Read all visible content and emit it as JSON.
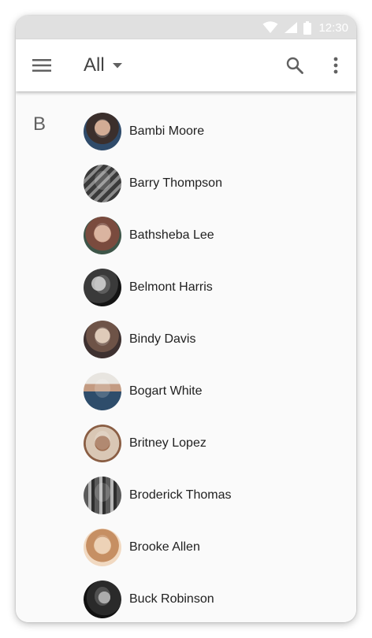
{
  "status_bar": {
    "time": "12:30",
    "icons": [
      "wifi-icon",
      "signal-icon",
      "battery-icon"
    ],
    "background": "#e0e0e0"
  },
  "app_bar": {
    "menu_icon": "menu-icon",
    "filter_label": "All",
    "filter_caret_icon": "arrow-drop-down-icon",
    "search_icon": "search-icon",
    "more_icon": "more-vert-icon"
  },
  "contacts": {
    "section_letter": "B",
    "items": [
      {
        "name": "Bambi Moore"
      },
      {
        "name": "Barry Thompson"
      },
      {
        "name": "Bathsheba Lee"
      },
      {
        "name": "Belmont Harris"
      },
      {
        "name": "Bindy Davis"
      },
      {
        "name": "Bogart White"
      },
      {
        "name": "Britney Lopez"
      },
      {
        "name": "Broderick Thomas"
      },
      {
        "name": "Brooke Allen"
      },
      {
        "name": "Buck Robinson"
      }
    ]
  }
}
